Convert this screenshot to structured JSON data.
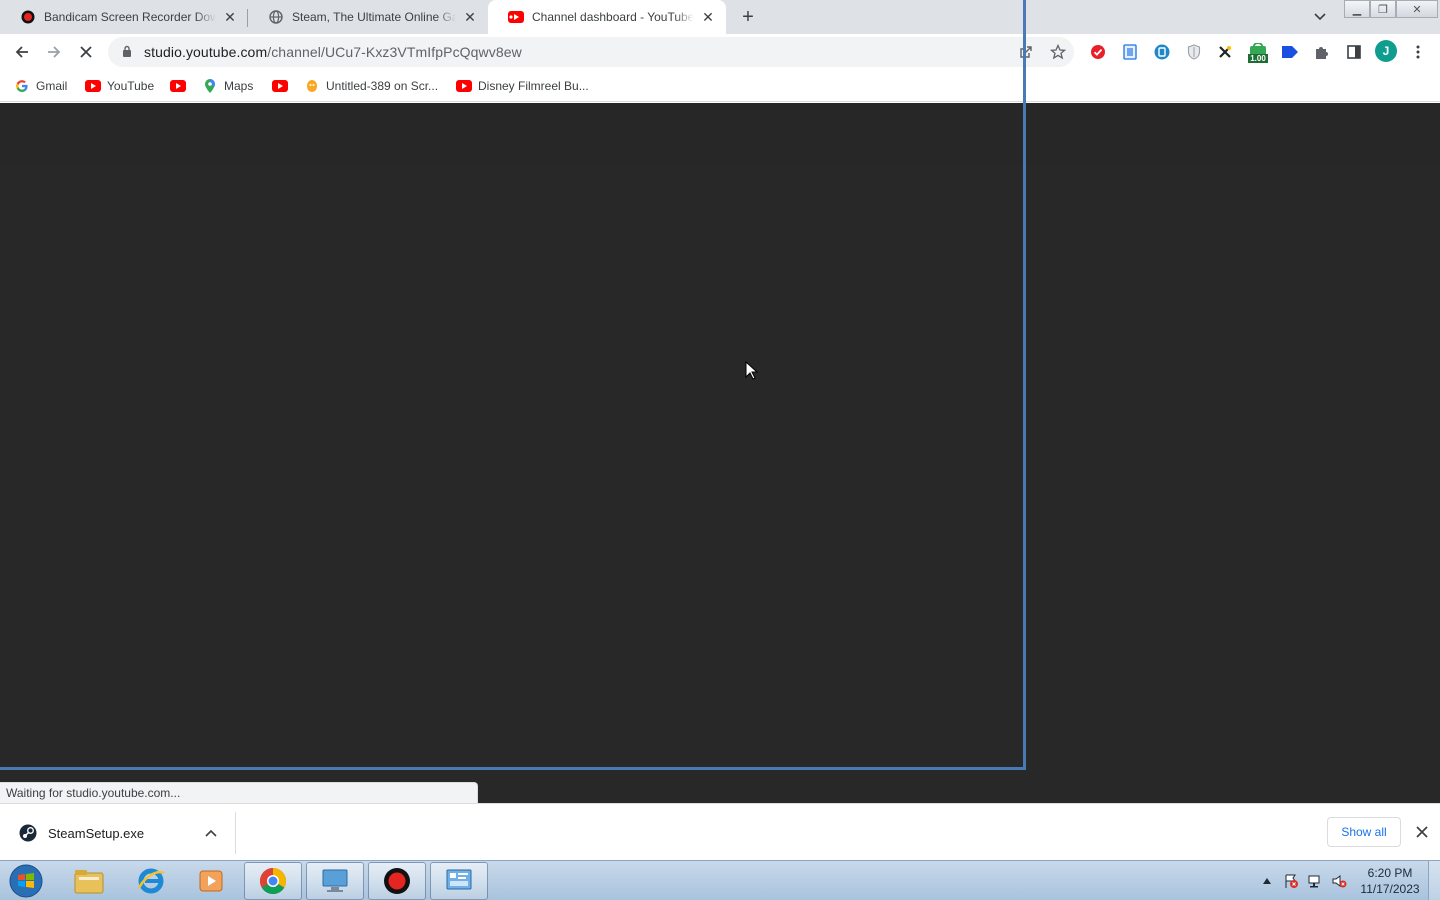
{
  "browser": {
    "tabs": [
      {
        "title": "Bandicam Screen Recorder Down",
        "favicon": "bandicam-icon",
        "active": false
      },
      {
        "title": "Steam, The Ultimate Online Gam",
        "favicon": "globe-icon",
        "active": false
      },
      {
        "title": "Channel dashboard - YouTube St",
        "favicon": "youtube-studio-icon",
        "active": true
      }
    ],
    "url": {
      "host": "studio.youtube.com",
      "path": "/channel/UCu7-Kxz3VTmIfpPcQqwv8ew"
    },
    "profile_initial": "J",
    "extension_badge": "1.00",
    "bookmarks": [
      {
        "label": "Gmail",
        "icon": "google-icon"
      },
      {
        "label": "YouTube",
        "icon": "youtube-icon"
      },
      {
        "label": "",
        "icon": "youtube-icon"
      },
      {
        "label": "Maps",
        "icon": "maps-pin-icon"
      },
      {
        "label": "",
        "icon": "youtube-icon"
      },
      {
        "label": "Untitled-389 on Scr...",
        "icon": "scratch-icon"
      },
      {
        "label": "Disney Filmreel Bu...",
        "icon": "youtube-icon"
      }
    ],
    "status_text": "Waiting for studio.youtube.com...",
    "colors": {
      "page_bg": "#282828",
      "frame_highlight": "#4a7ab3",
      "link": "#1a73e8"
    }
  },
  "downloads": {
    "items": [
      {
        "name": "SteamSetup.exe",
        "icon": "steam-icon"
      }
    ],
    "show_all_label": "Show all"
  },
  "taskbar": {
    "apps": [
      "windows-explorer-icon",
      "internet-explorer-icon",
      "media-player-icon",
      "chrome-icon",
      "remote-desktop-icon",
      "bandicam-icon",
      "control-panel-icon"
    ],
    "clock_time": "6:20 PM",
    "clock_date": "11/17/2023"
  }
}
